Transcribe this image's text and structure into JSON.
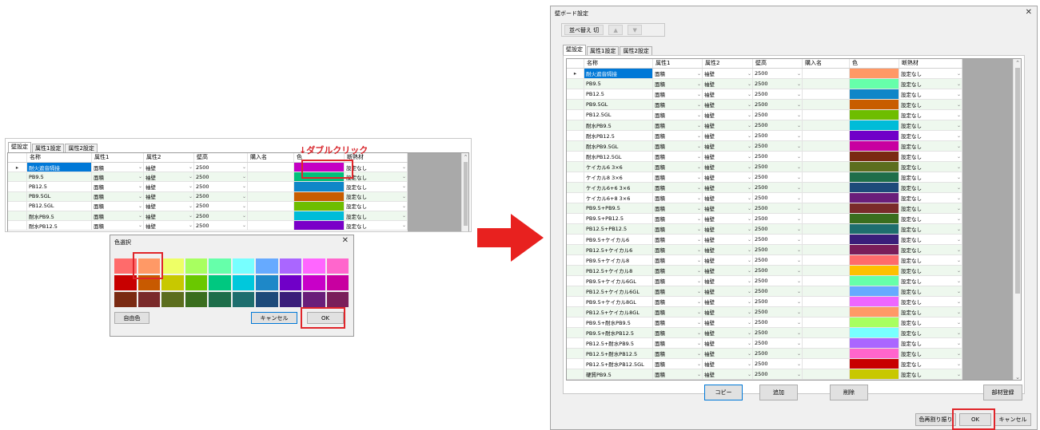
{
  "annotation": "↓ダブルクリック",
  "tabs": [
    "壁設定",
    "属性1設定",
    "属性2設定"
  ],
  "columns": [
    "名称",
    "属性1",
    "属性2",
    "壁高",
    "購入名",
    "色",
    "断熱材"
  ],
  "small_rows": [
    {
      "name": "耐火遮音隔接",
      "a1": "面積",
      "a2": "袖壁",
      "h": "2500",
      "c": "#c400c4",
      "ins": "設定なし"
    },
    {
      "name": "PB9.5",
      "a1": "面積",
      "a2": "袖壁",
      "h": "2500",
      "c": "#00c07b",
      "ins": "設定なし"
    },
    {
      "name": "PB12.5",
      "a1": "面積",
      "a2": "袖壁",
      "h": "2500",
      "c": "#0f86c8",
      "ins": "設定なし"
    },
    {
      "name": "PB9.5GL",
      "a1": "面積",
      "a2": "袖壁",
      "h": "2500",
      "c": "#c85d00",
      "ins": "設定なし"
    },
    {
      "name": "PB12.5GL",
      "a1": "面積",
      "a2": "袖壁",
      "h": "2500",
      "c": "#6ebd00",
      "ins": "設定なし"
    },
    {
      "name": "耐水PB9.5",
      "a1": "面積",
      "a2": "袖壁",
      "h": "2500",
      "c": "#00bcd8",
      "ins": "設定なし"
    },
    {
      "name": "耐水PB12.5",
      "a1": "面積",
      "a2": "袖壁",
      "h": "2500",
      "c": "#7a00c8",
      "ins": "設定なし"
    }
  ],
  "color_dialog": {
    "title": "色選択",
    "close": "✕",
    "swatches": [
      "#ff6b6b",
      "#ff9966",
      "#eeff66",
      "#a8ff60",
      "#66ffaa",
      "#77ffff",
      "#66aaff",
      "#aa66ff",
      "#ff66ff",
      "#ff66cc",
      "#c80000",
      "#c85a00",
      "#c8c800",
      "#6ac800",
      "#00c880",
      "#00c8dc",
      "#1e88c8",
      "#7000c8",
      "#c800c8",
      "#c800a0",
      "#7a2a12",
      "#7a2a2a",
      "#5c6e1e",
      "#3a6e1e",
      "#1e6e4a",
      "#1e6e6e",
      "#1e4a7a",
      "#3a1e7a",
      "#6a1e7a",
      "#7a1e5a"
    ],
    "custom_label": "自由色",
    "cancel_label": "キャンセル",
    "ok_label": "OK"
  },
  "main_dialog": {
    "title": "壁ボード設定",
    "close": "✕",
    "sort_label": "並べ替え 切",
    "up_label": "▲",
    "down_label": "▼",
    "copy_label": "コピー",
    "add_label": "追加",
    "delete_label": "削除",
    "register_label": "部材登録",
    "reassign_label": "色再割り振り",
    "ok_label": "OK",
    "cancel_label": "キャンセル"
  },
  "big_rows": [
    {
      "name": "耐火遮音隔接",
      "a1": "面積",
      "a2": "袖壁",
      "h": "2500",
      "c": "#ff9966",
      "ins": "設定なし"
    },
    {
      "name": "PB9.5",
      "a1": "面積",
      "a2": "袖壁",
      "h": "2500",
      "c": "#66ffaa",
      "ins": "設定なし"
    },
    {
      "name": "PB12.5",
      "a1": "面積",
      "a2": "袖壁",
      "h": "2500",
      "c": "#0f86c8",
      "ins": "設定なし"
    },
    {
      "name": "PB9.5GL",
      "a1": "面積",
      "a2": "袖壁",
      "h": "2500",
      "c": "#c85d00",
      "ins": "設定なし"
    },
    {
      "name": "PB12.5GL",
      "a1": "面積",
      "a2": "袖壁",
      "h": "2500",
      "c": "#6ebd00",
      "ins": "設定なし"
    },
    {
      "name": "耐水PB9.5",
      "a1": "面積",
      "a2": "袖壁",
      "h": "2500",
      "c": "#00bcd8",
      "ins": "設定なし"
    },
    {
      "name": "耐水PB12.5",
      "a1": "面積",
      "a2": "袖壁",
      "h": "2500",
      "c": "#7000c8",
      "ins": "設定なし"
    },
    {
      "name": "耐水PB9.5GL",
      "a1": "面積",
      "a2": "袖壁",
      "h": "2500",
      "c": "#c800a0",
      "ins": "設定なし"
    },
    {
      "name": "耐水PB12.5GL",
      "a1": "面積",
      "a2": "袖壁",
      "h": "2500",
      "c": "#7a2a12",
      "ins": "設定なし"
    },
    {
      "name": "ケイカル6 3×6",
      "a1": "面積",
      "a2": "袖壁",
      "h": "2500",
      "c": "#5c6e1e",
      "ins": "設定なし"
    },
    {
      "name": "ケイカル8 3×6",
      "a1": "面積",
      "a2": "袖壁",
      "h": "2500",
      "c": "#1e6e4a",
      "ins": "設定なし"
    },
    {
      "name": "ケイカル6+6 3×6",
      "a1": "面積",
      "a2": "袖壁",
      "h": "2500",
      "c": "#1e4a7a",
      "ins": "設定なし"
    },
    {
      "name": "ケイカル6+8 3×6",
      "a1": "面積",
      "a2": "袖壁",
      "h": "2500",
      "c": "#6a1e7a",
      "ins": "設定なし"
    },
    {
      "name": "PB9.5+PB9.5",
      "a1": "面積",
      "a2": "袖壁",
      "h": "2500",
      "c": "#7a2a2a",
      "ins": "設定なし"
    },
    {
      "name": "PB9.5+PB12.5",
      "a1": "面積",
      "a2": "袖壁",
      "h": "2500",
      "c": "#3a6e1e",
      "ins": "設定なし"
    },
    {
      "name": "PB12.5+PB12.5",
      "a1": "面積",
      "a2": "袖壁",
      "h": "2500",
      "c": "#1e6e6e",
      "ins": "設定なし"
    },
    {
      "name": "PB9.5+ケイカル6",
      "a1": "面積",
      "a2": "袖壁",
      "h": "2500",
      "c": "#3a1e7a",
      "ins": "設定なし"
    },
    {
      "name": "PB12.5+ケイカル6",
      "a1": "面積",
      "a2": "袖壁",
      "h": "2500",
      "c": "#7a1e5a",
      "ins": "設定なし"
    },
    {
      "name": "PB9.5+ケイカル8",
      "a1": "面積",
      "a2": "袖壁",
      "h": "2500",
      "c": "#ff6b6b",
      "ins": "設定なし"
    },
    {
      "name": "PB12.5+ケイカル8",
      "a1": "面積",
      "a2": "袖壁",
      "h": "2500",
      "c": "#ffc000",
      "ins": "設定なし"
    },
    {
      "name": "PB9.5+ケイカル6GL",
      "a1": "面積",
      "a2": "袖壁",
      "h": "2500",
      "c": "#66ffaa",
      "ins": "設定なし"
    },
    {
      "name": "PB12.5+ケイカル6GL",
      "a1": "面積",
      "a2": "袖壁",
      "h": "2500",
      "c": "#66aaff",
      "ins": "設定なし"
    },
    {
      "name": "PB9.5+ケイカル8GL",
      "a1": "面積",
      "a2": "袖壁",
      "h": "2500",
      "c": "#ee66ff",
      "ins": "設定なし"
    },
    {
      "name": "PB12.5+ケイカル8GL",
      "a1": "面積",
      "a2": "袖壁",
      "h": "2500",
      "c": "#ff9966",
      "ins": "設定なし"
    },
    {
      "name": "PB9.5+耐水PB9.5",
      "a1": "面積",
      "a2": "袖壁",
      "h": "2500",
      "c": "#a8ff60",
      "ins": "設定なし"
    },
    {
      "name": "PB9.5+耐水PB12.5",
      "a1": "面積",
      "a2": "袖壁",
      "h": "2500",
      "c": "#77ffff",
      "ins": "設定なし"
    },
    {
      "name": "PB12.5+耐水PB9.5",
      "a1": "面積",
      "a2": "袖壁",
      "h": "2500",
      "c": "#aa66ff",
      "ins": "設定なし"
    },
    {
      "name": "PB12.5+耐水PB12.5",
      "a1": "面積",
      "a2": "袖壁",
      "h": "2500",
      "c": "#ff66cc",
      "ins": "設定なし"
    },
    {
      "name": "PB12.5+耐水PB12.5GL",
      "a1": "面積",
      "a2": "袖壁",
      "h": "2500",
      "c": "#c80000",
      "ins": "設定なし"
    },
    {
      "name": "硬質PB9.5",
      "a1": "面積",
      "a2": "袖壁",
      "h": "2500",
      "c": "#c8c800",
      "ins": "設定なし"
    }
  ]
}
